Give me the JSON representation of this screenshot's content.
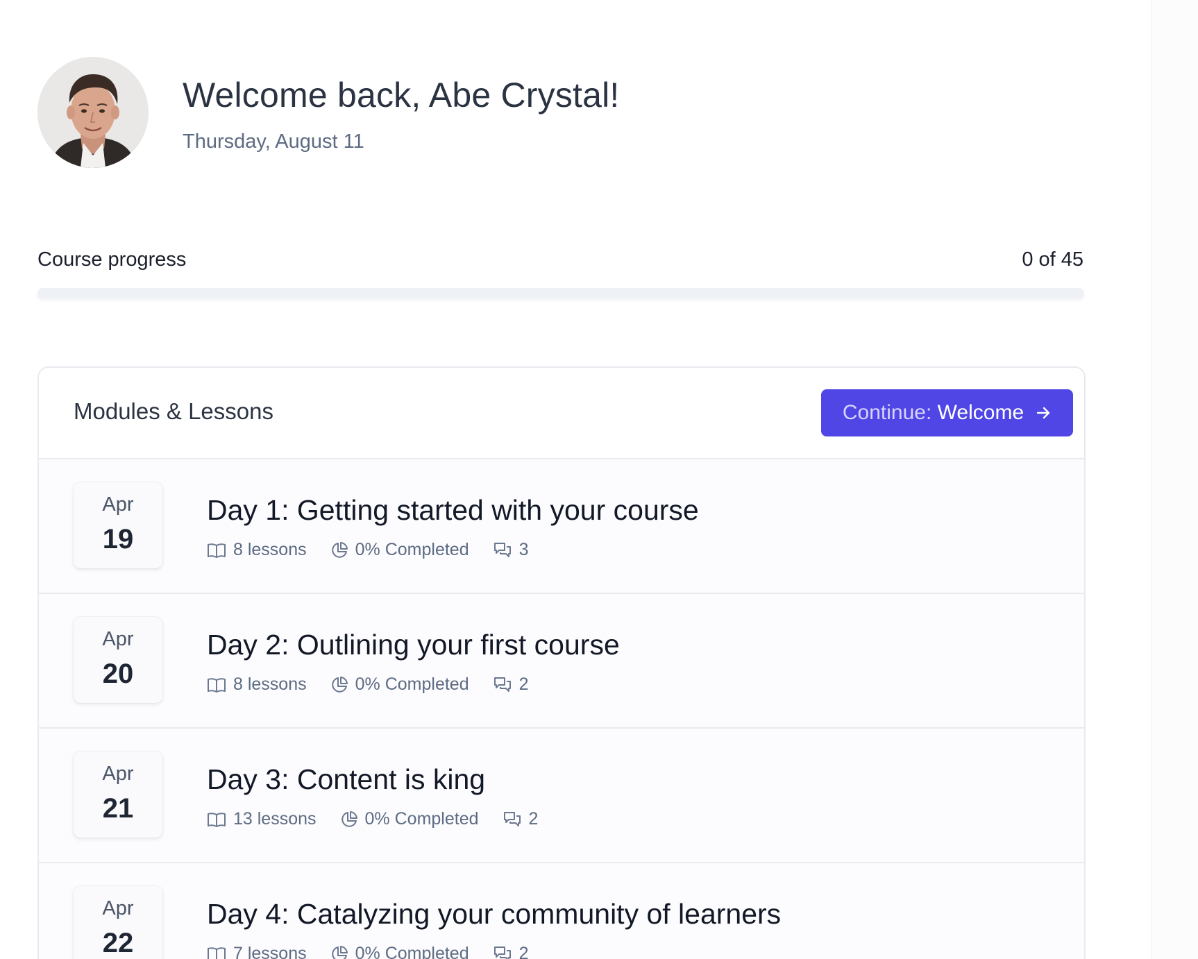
{
  "header": {
    "greeting": "Welcome back, Abe Crystal!",
    "date": "Thursday, August 11"
  },
  "progress": {
    "label": "Course progress",
    "count_text": "0 of 45",
    "completed": 0,
    "total": 45,
    "fraction": 0
  },
  "modules_card": {
    "title": "Modules & Lessons",
    "continue_prefix": "Continue:",
    "continue_target": "Welcome",
    "accent_color": "#4f46e5"
  },
  "modules": [
    {
      "month": "Apr",
      "day": "19",
      "title": "Day 1: Getting started with your course",
      "lessons": "8 lessons",
      "completed": "0% Completed",
      "comments": "3"
    },
    {
      "month": "Apr",
      "day": "20",
      "title": "Day 2: Outlining your first course",
      "lessons": "8 lessons",
      "completed": "0% Completed",
      "comments": "2"
    },
    {
      "month": "Apr",
      "day": "21",
      "title": "Day 3: Content is king",
      "lessons": "13 lessons",
      "completed": "0% Completed",
      "comments": "2"
    },
    {
      "month": "Apr",
      "day": "22",
      "title": "Day 4: Catalyzing your community of learners",
      "lessons": "7 lessons",
      "completed": "0% Completed",
      "comments": "2"
    }
  ],
  "icons": {
    "lessons": "book-open-icon",
    "completion": "pie-chart-icon",
    "comments": "chat-bubbles-icon",
    "continue": "arrow-right-icon"
  }
}
